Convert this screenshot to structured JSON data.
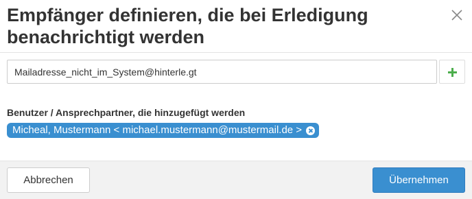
{
  "dialog": {
    "title": "Empfänger definieren, die bei Erledigung benachrichtigt werden",
    "close_icon": "close-icon"
  },
  "input": {
    "value": "Mailadresse_nicht_im_System@hinterle.gt",
    "placeholder": ""
  },
  "add_button": {
    "icon": "plus-icon",
    "color": "#4cae4c"
  },
  "recipients": {
    "label": "Benutzer / Ansprechpartner, die hinzugefügt werden",
    "items": [
      {
        "text": "Micheal, Mustermann < michael.mustermann@mustermail.de >",
        "remove_icon": "remove-icon"
      }
    ]
  },
  "footer": {
    "cancel_label": "Abbrechen",
    "ok_label": "Übernehmen"
  },
  "colors": {
    "accent": "#3a8fd0",
    "add": "#4cae4c",
    "footer_bg": "#f2f2f2"
  }
}
